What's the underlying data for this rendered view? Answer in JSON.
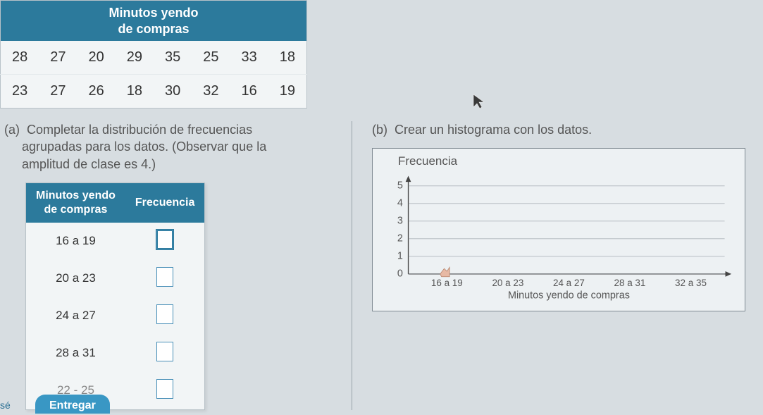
{
  "data_table": {
    "header_line1": "Minutos yendo",
    "header_line2": "de compras",
    "rows": [
      [
        28,
        27,
        20,
        29,
        35,
        25,
        33,
        18
      ],
      [
        23,
        27,
        26,
        18,
        30,
        32,
        16,
        19
      ]
    ]
  },
  "part_a": {
    "label": "(a)",
    "prompt_line1": "Completar la distribución de frecuencias",
    "prompt_line2": "agrupadas para los datos. (Observar que la",
    "prompt_line3": "amplitud de clase es 4.)",
    "freq_header_col1_line1": "Minutos yendo",
    "freq_header_col1_line2": "de compras",
    "freq_header_col2": "Frecuencia",
    "classes": [
      "16 a 19",
      "20 a 23",
      "24 a 27",
      "28 a 31",
      "32 a 35"
    ],
    "classes_visible_last_partial": "22 - 25"
  },
  "part_b": {
    "label": "(b)",
    "prompt": "Crear un histograma con los datos."
  },
  "chart_data": {
    "type": "bar",
    "title": "Frecuencia",
    "ylabel": "",
    "xlabel": "Minutos yendo de compras",
    "ylim": [
      0,
      5
    ],
    "yticks": [
      0,
      1,
      2,
      3,
      4,
      5
    ],
    "categories": [
      "16 a 19",
      "20 a 23",
      "24 a 27",
      "28 a 31",
      "32 a 35"
    ],
    "values": [
      null,
      null,
      null,
      null,
      null
    ]
  },
  "footer": {
    "nose": "sé",
    "entregar": "Entregar"
  }
}
